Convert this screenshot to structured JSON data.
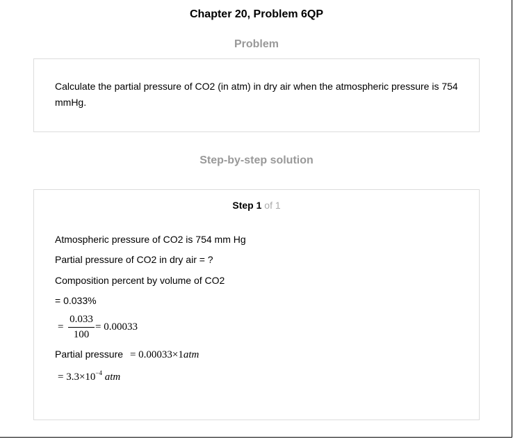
{
  "header": {
    "title": "Chapter 20, Problem 6QP"
  },
  "problem": {
    "heading": "Problem",
    "text": "Calculate the partial pressure of CO2 (in atm) in dry air when the atmospheric pressure is 754 mmHg."
  },
  "solution": {
    "heading": "Step-by-step solution",
    "step_word": "Step",
    "step_number": "1",
    "step_of": "of 1",
    "lines": [
      "Atmospheric pressure of CO2 is 754 mm Hg",
      "Partial pressure of CO2 in dry air = ?",
      "Composition percent by volume of CO2",
      "= 0.033%"
    ],
    "fraction": {
      "eq": "=",
      "numerator": "0.033",
      "denominator": "100",
      "result": "= 0.00033"
    },
    "partial_label": "Partial pressure",
    "partial_expr_prefix": "= 0.00033×1",
    "partial_expr_unit": "atm",
    "final_prefix": "= 3.3×10",
    "final_exp": "−4",
    "final_unit": "atm"
  }
}
